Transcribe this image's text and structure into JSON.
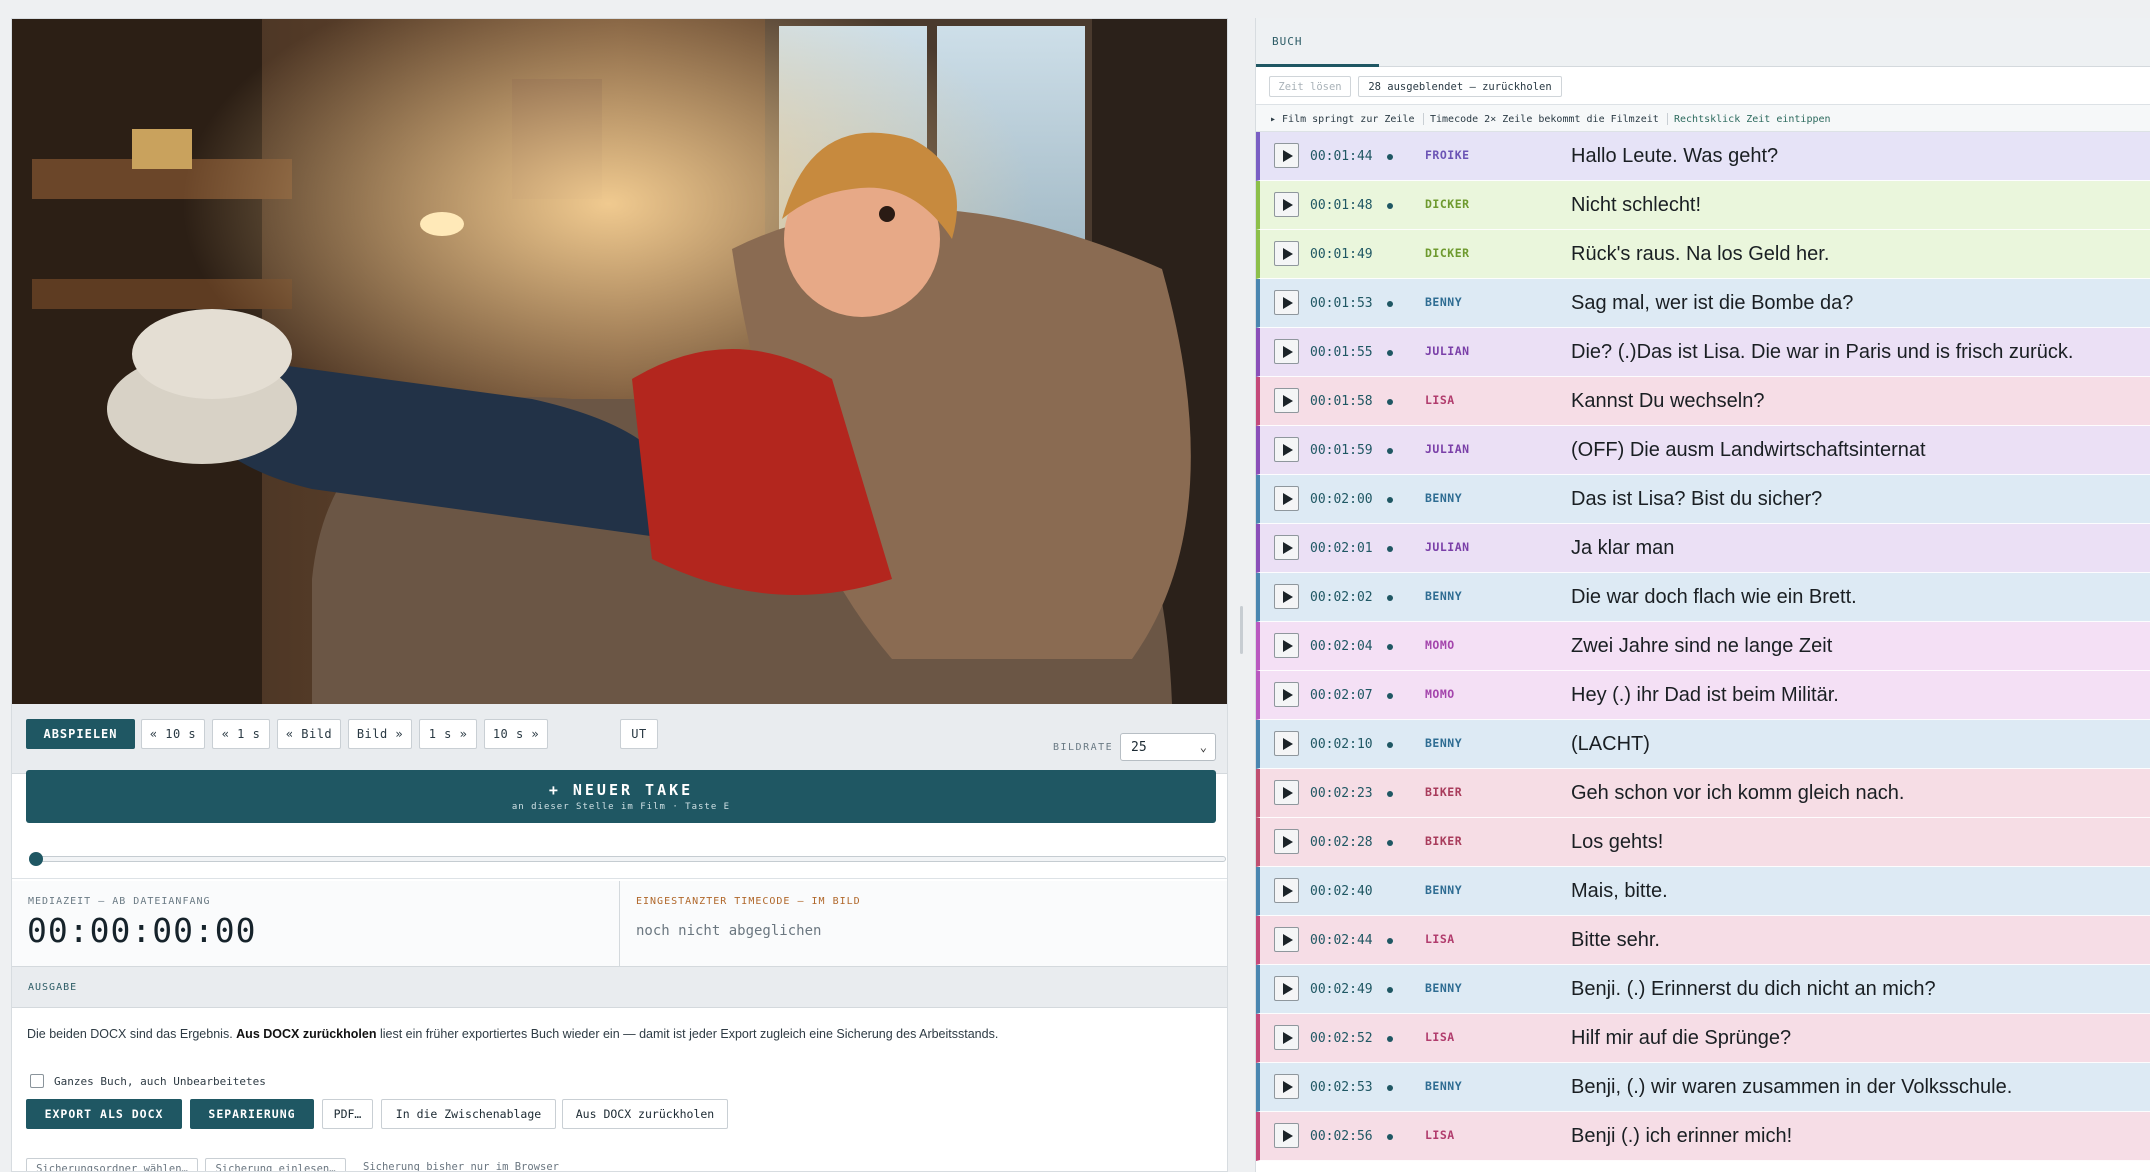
{
  "transport": {
    "play_label": "ABSPIELEN",
    "back_10s": "« 10 s",
    "back_1s": "« 1 s",
    "back_frame": "« Bild",
    "fwd_frame": "Bild »",
    "fwd_1s": "1 s »",
    "fwd_10s": "10 s »",
    "subtitles": "UT",
    "framerate_label": "BILDRATE",
    "framerate_value": "25"
  },
  "new_take": {
    "title": "+ NEUER TAKE",
    "subtitle": "an dieser Stelle im Film · Taste E"
  },
  "scrubber": {
    "progress": 0
  },
  "timecodes": {
    "media_label": "MEDIAZEIT — AB DATEIANFANG",
    "media_value": "00:00:00:00",
    "burned_label": "EINGESTANZTER TIMECODE — IM BILD",
    "burned_value": "noch nicht abgeglichen"
  },
  "output": {
    "heading": "AUSGABE",
    "desc_pre": "Die beiden DOCX sind das Ergebnis.",
    "desc_bold": "Aus DOCX zurückholen",
    "desc_post": "liest ein früher exportiertes Buch wieder ein — damit ist jeder Export zugleich eine Sicherung des Arbeitsstands.",
    "checkbox_label": "Ganzes Buch, auch Unbearbeitetes",
    "export_docx": "EXPORT ALS DOCX",
    "separation": "SEPARIERUNG",
    "pdf": "PDF…",
    "clipboard": "In die Zwischenablage",
    "restore_docx": "Aus DOCX zurückholen",
    "choose_backup_folder": "Sicherungsordner wählen…",
    "load_backup": "Sicherung einlesen…",
    "backup_status": "Sicherung bisher nur im Browser"
  },
  "script": {
    "tab": "BUCH",
    "clear_time": "Zeit lösen",
    "hidden_restore": "28 ausgeblendet — zurückholen",
    "hint1": "▸ Film springt zur Zeile",
    "hint2": "Timecode 2× Zeile bekommt die Filmzeit",
    "hint3": "Rechtsklick Zeit eintippen",
    "roles": {
      "FROIKE": {
        "bg": "#e6e3f7",
        "bar": "#7a5fc4",
        "fg": "#6b54b5"
      },
      "DICKER": {
        "bg": "#eaf6dc",
        "bar": "#8cbf4a",
        "fg": "#6e9a2e"
      },
      "BENNY": {
        "bg": "#ddeaf4",
        "bar": "#4a86b0",
        "fg": "#2f6d93"
      },
      "JULIAN": {
        "bg": "#ebe0f5",
        "bar": "#8a4fb9",
        "fg": "#7a3fa8"
      },
      "LISA": {
        "bg": "#f6dde6",
        "bar": "#c4497a",
        "fg": "#b13c6d"
      },
      "MOMO": {
        "bg": "#f4e0f5",
        "bar": "#b959c0",
        "fg": "#a445ac"
      },
      "BIKER": {
        "bg": "#f6dde5",
        "bar": "#c04f70",
        "fg": "#a83b5b"
      }
    },
    "lines": [
      {
        "tc": "00:01:44",
        "role": "FROIKE",
        "text": "Hallo Leute. Was geht?",
        "dot": true
      },
      {
        "tc": "00:01:48",
        "role": "DICKER",
        "text": "Nicht schlecht!",
        "dot": true
      },
      {
        "tc": "00:01:49",
        "role": "DICKER",
        "text": "Rück's raus. Na los  Geld her.",
        "dot": false
      },
      {
        "tc": "00:01:53",
        "role": "BENNY",
        "text": "Sag mal, wer ist die Bombe da?",
        "dot": true
      },
      {
        "tc": "00:01:55",
        "role": "JULIAN",
        "text": "Die? (.)Das ist Lisa. Die war in Paris und is frisch zurück.",
        "dot": true
      },
      {
        "tc": "00:01:58",
        "role": "LISA",
        "text": "Kannst Du wechseln?",
        "dot": true
      },
      {
        "tc": "00:01:59",
        "role": "JULIAN",
        "text": "(OFF) Die ausm Landwirtschaftsinternat",
        "dot": true
      },
      {
        "tc": "00:02:00",
        "role": "BENNY",
        "text": "Das ist Lisa? Bist du sicher?",
        "dot": true
      },
      {
        "tc": "00:02:01",
        "role": "JULIAN",
        "text": "Ja klar man",
        "dot": true
      },
      {
        "tc": "00:02:02",
        "role": "BENNY",
        "text": "Die war doch flach wie ein Brett.",
        "dot": true
      },
      {
        "tc": "00:02:04",
        "role": "MOMO",
        "text": "Zwei Jahre sind ne lange Zeit",
        "dot": true
      },
      {
        "tc": "00:02:07",
        "role": "MOMO",
        "text": "Hey (.) ihr Dad ist beim Militär.",
        "dot": true
      },
      {
        "tc": "00:02:10",
        "role": "BENNY",
        "text": "(LACHT)",
        "dot": true
      },
      {
        "tc": "00:02:23",
        "role": "BIKER",
        "text": "Geh schon vor ich komm gleich nach.",
        "dot": true
      },
      {
        "tc": "00:02:28",
        "role": "BIKER",
        "text": "Los gehts!",
        "dot": true
      },
      {
        "tc": "00:02:40",
        "role": "BENNY",
        "text": "Mais, bitte.",
        "dot": false
      },
      {
        "tc": "00:02:44",
        "role": "LISA",
        "text": "Bitte sehr.",
        "dot": true
      },
      {
        "tc": "00:02:49",
        "role": "BENNY",
        "text": "Benji. (.) Erinnerst du dich nicht an mich?",
        "dot": true
      },
      {
        "tc": "00:02:52",
        "role": "LISA",
        "text": "Hilf mir auf die Sprünge?",
        "dot": true
      },
      {
        "tc": "00:02:53",
        "role": "BENNY",
        "text": "Benji, (.) wir waren zusammen in der Volksschule.",
        "dot": true
      },
      {
        "tc": "00:02:56",
        "role": "LISA",
        "text": "Benji (.) ich erinner mich!",
        "dot": true
      }
    ]
  }
}
